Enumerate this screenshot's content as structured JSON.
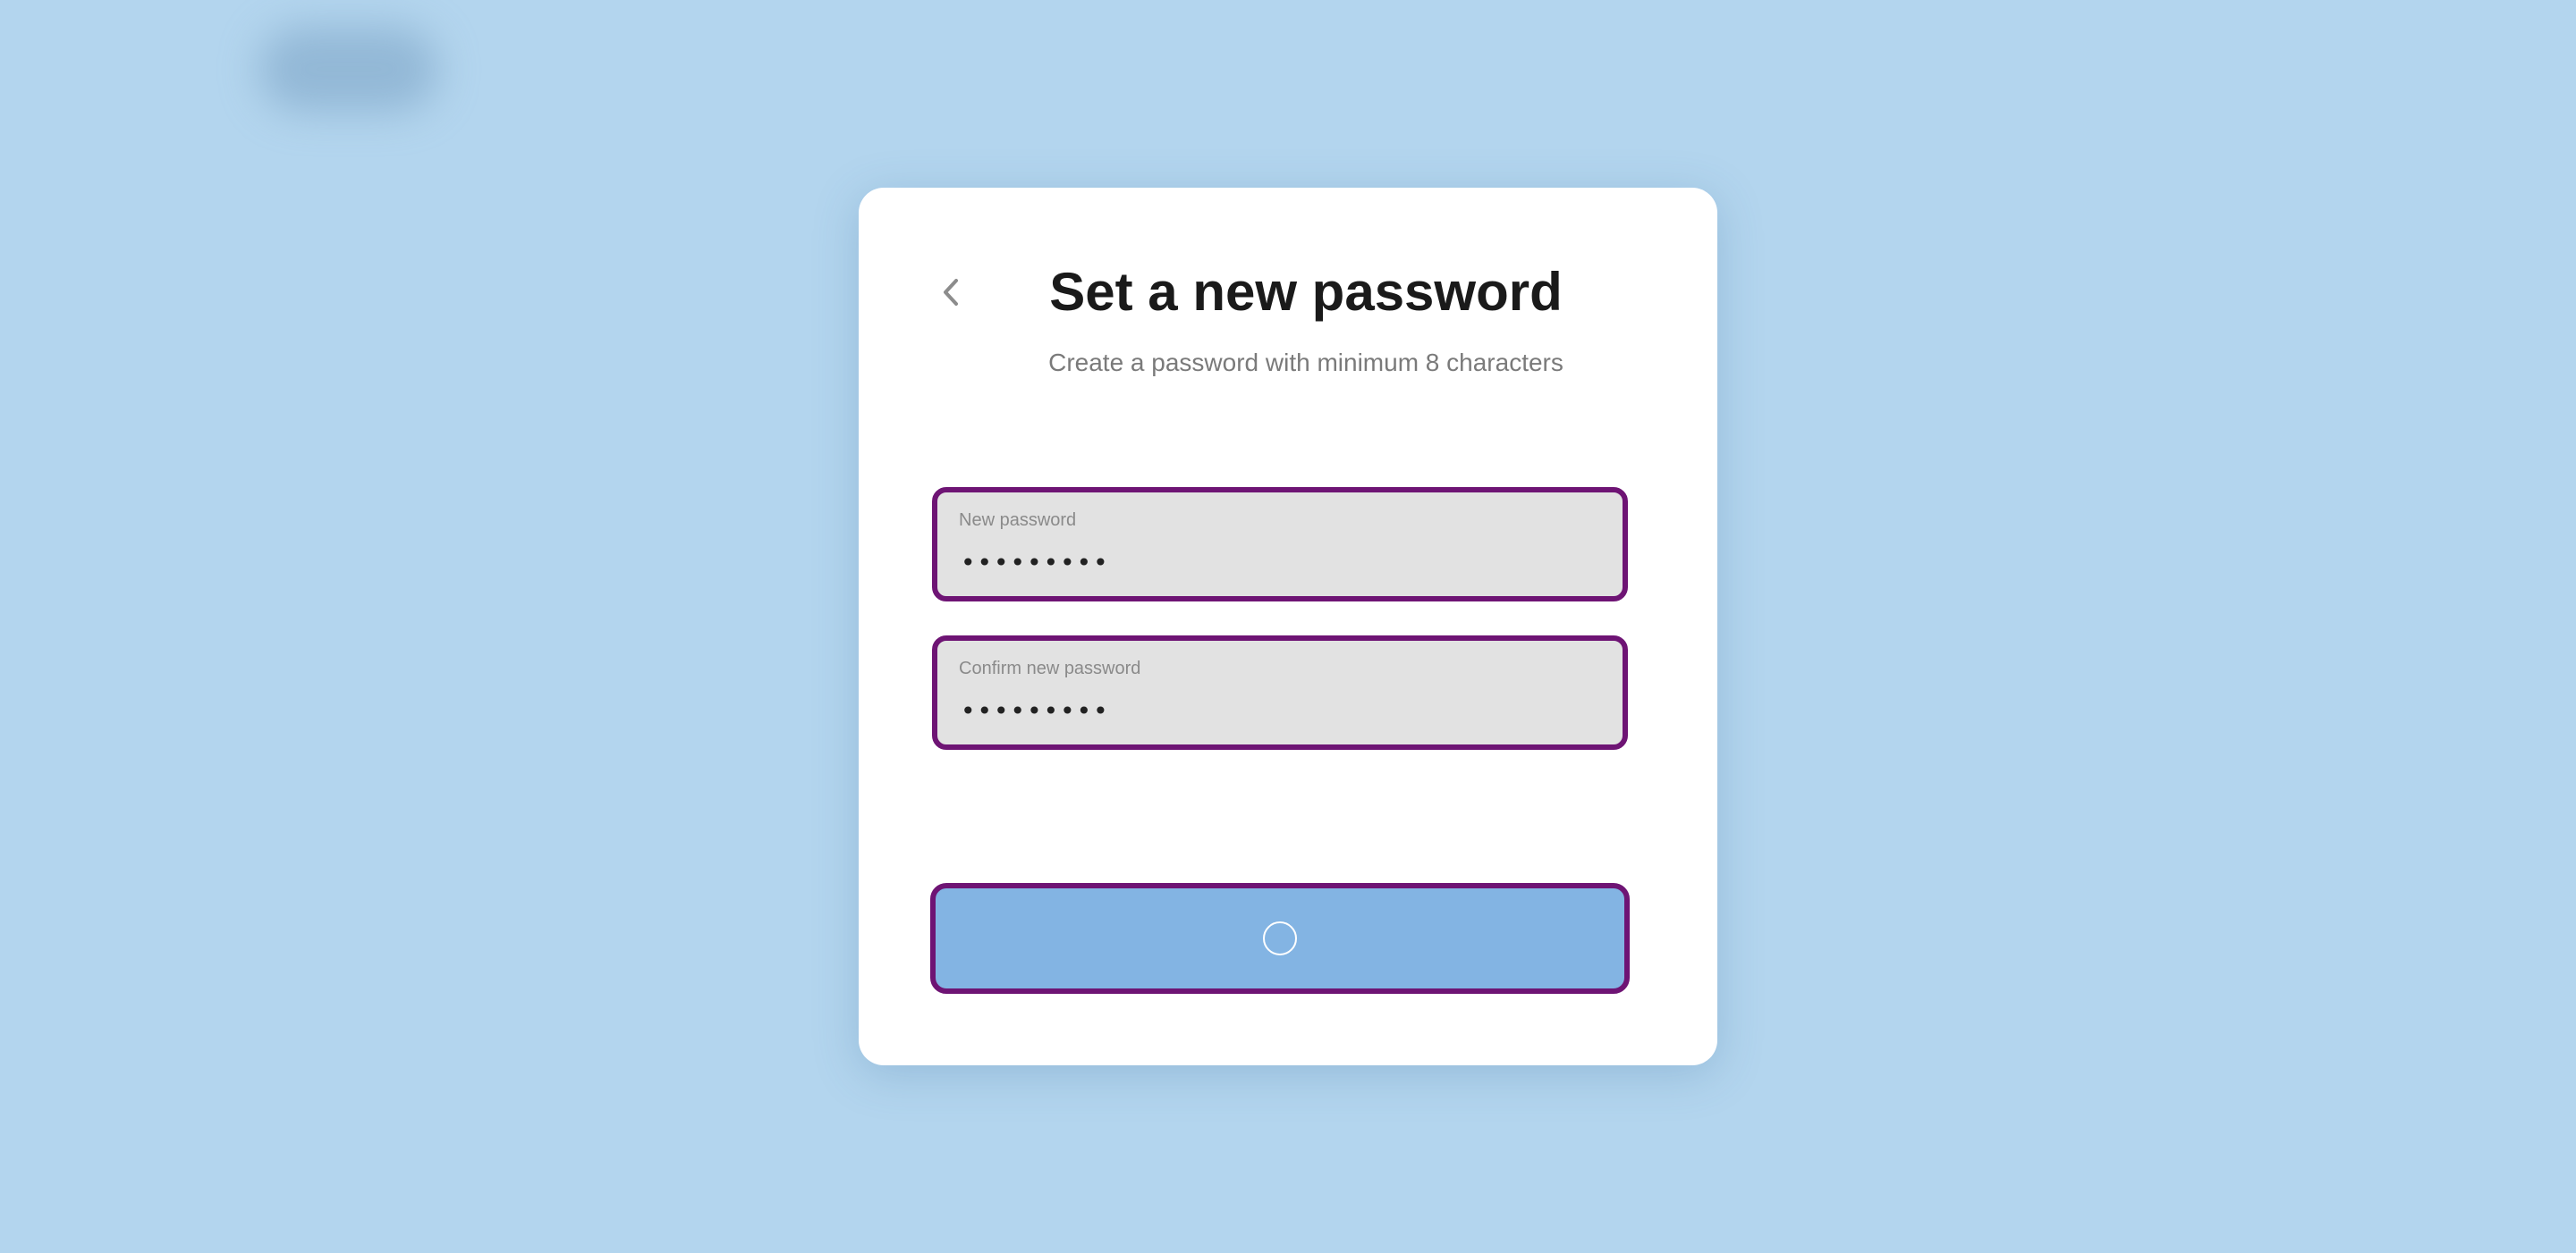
{
  "page": {
    "title": "Set a new password",
    "subtitle": "Create a password with minimum 8 characters"
  },
  "fields": [
    {
      "label": "New password",
      "value": "•••••••••"
    },
    {
      "label": "Confirm new password",
      "value": "•••••••••"
    }
  ],
  "submit": {
    "label": "",
    "state": "loading"
  },
  "icons": {
    "back": "chevron-left-icon",
    "spinner": "loading-spinner-icon"
  },
  "colors": {
    "background": "#b3d5ee",
    "card": "#ffffff",
    "field_border": "#6e1474",
    "field_fill": "#e2e2e2",
    "button_fill": "#83b4e3"
  }
}
